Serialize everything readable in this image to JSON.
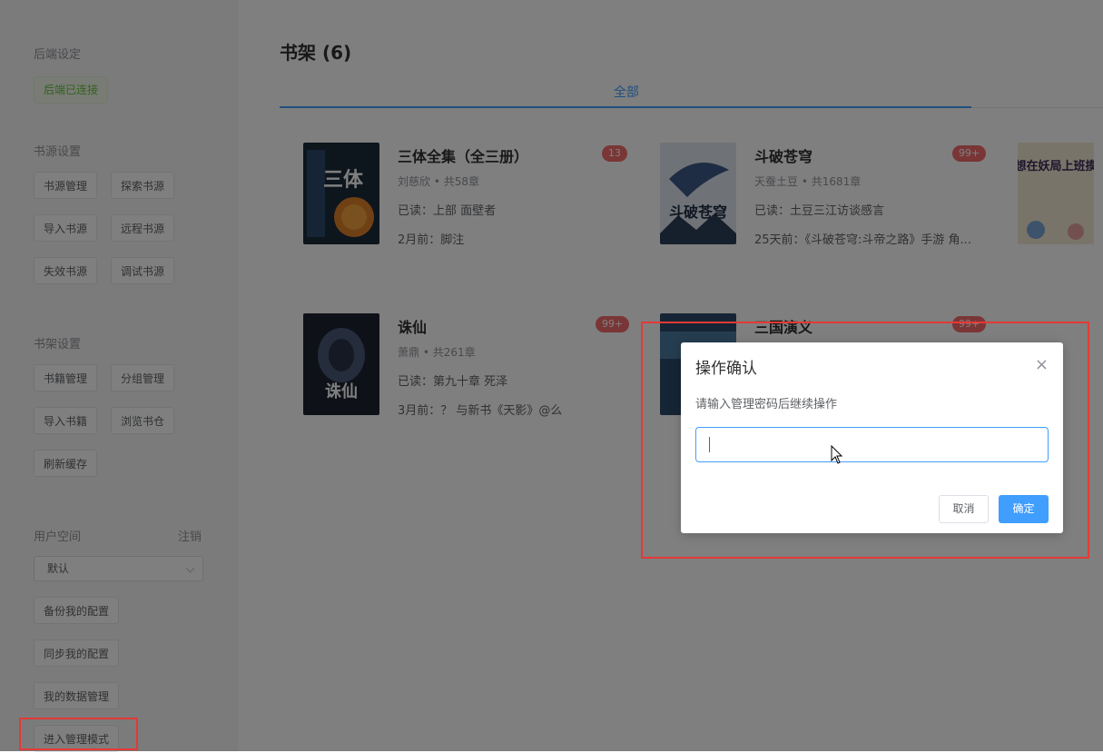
{
  "sidebar": {
    "backend": {
      "title": "后端设定",
      "status": "后端已连接"
    },
    "source": {
      "title": "书源设置",
      "buttons": [
        "书源管理",
        "探索书源",
        "导入书源",
        "远程书源",
        "失效书源",
        "调试书源"
      ]
    },
    "shelf": {
      "title": "书架设置",
      "buttons": [
        "书籍管理",
        "分组管理",
        "导入书籍",
        "浏览书仓",
        "刷新缓存"
      ]
    },
    "user": {
      "title": "用户空间",
      "logout": "注销",
      "select_value": "默认",
      "buttons": [
        "备份我的配置",
        "同步我的配置",
        "我的数据管理",
        "进入管理模式"
      ]
    }
  },
  "main": {
    "title": "书架 (6)",
    "tab": "全部",
    "books": [
      {
        "title": "三体全集（全三册）",
        "meta": "刘慈欣 • 共58章",
        "read": "已读：上部 面壁者",
        "latest": "2月前：脚注",
        "badge": "13",
        "cover_text": "三体"
      },
      {
        "title": "斗破苍穹",
        "meta": "天蚕土豆 • 共1681章",
        "read": "已读：土豆三江访谈感言",
        "latest": "25天前：《斗破苍穹:斗帝之路》手游 角...",
        "badge": "99+",
        "cover_text": "斗破苍穹"
      },
      {
        "title": "诛仙",
        "meta": "萧鼎 • 共261章",
        "read": "已读：第九十章 死泽",
        "latest": "3月前：？ 与新书《天影》@么",
        "badge": "99+",
        "cover_text": "诛仙"
      },
      {
        "title": "三国演义",
        "badge": "99+"
      },
      {
        "cover_text": "我想在妖局上班摸鱼"
      }
    ]
  },
  "dialog": {
    "title": "操作确认",
    "close": "×",
    "message": "请输入管理密码后继续操作",
    "input_value": "",
    "cancel": "取消",
    "confirm": "确定"
  },
  "colors": {
    "primary": "#409eff",
    "danger": "#f56c6c",
    "success": "#67c23a",
    "highlight": "#e53935"
  }
}
